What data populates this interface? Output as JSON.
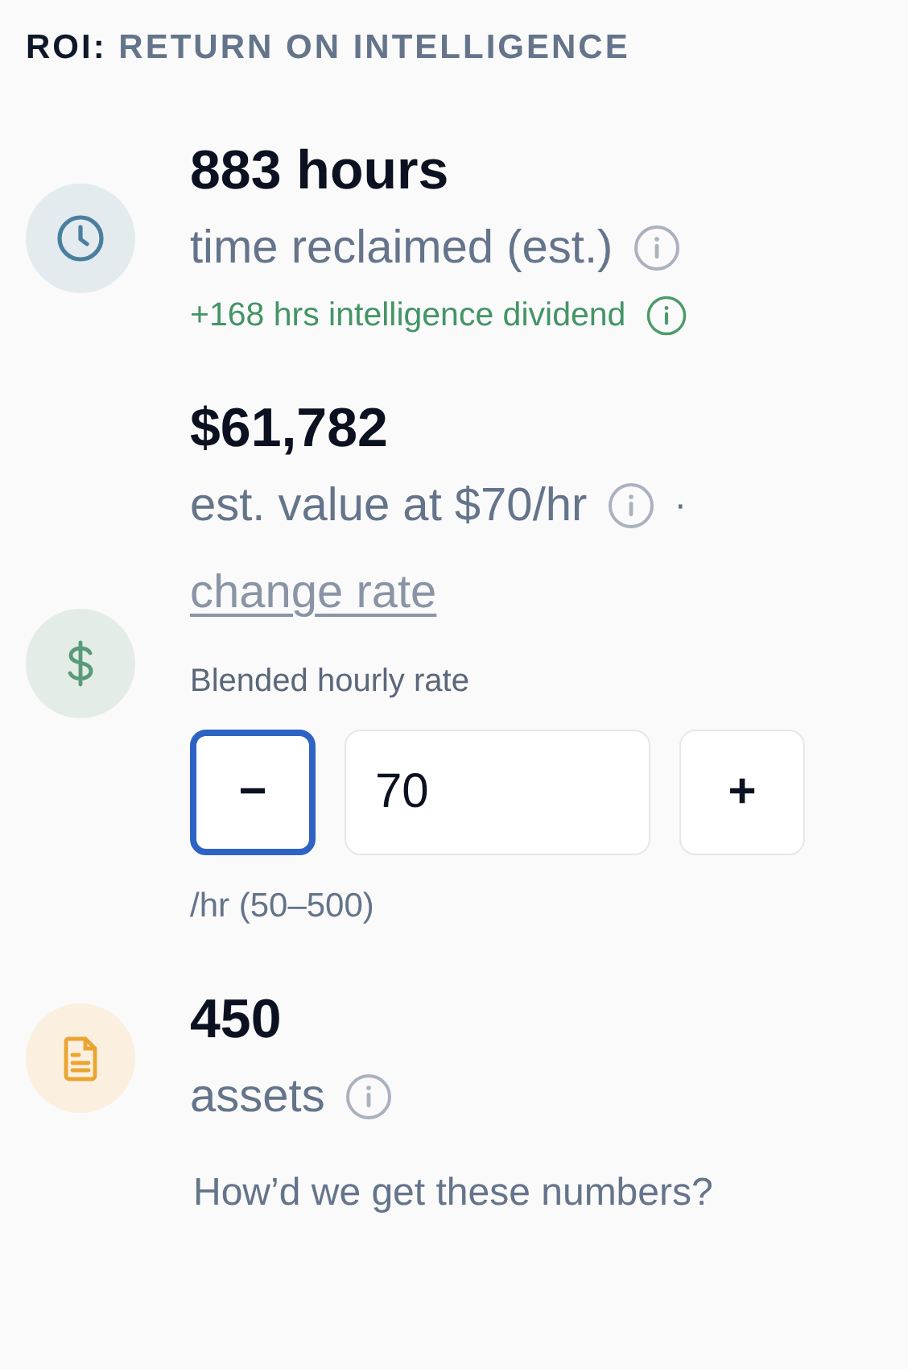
{
  "header": {
    "prefix": "ROI:",
    "title": "RETURN ON INTELLIGENCE"
  },
  "metrics": [
    {
      "kind": "clock",
      "value": "883 hours",
      "label": "time reclaimed (est.)",
      "info": true,
      "note": "+168 hrs intelligence dividend"
    },
    {
      "kind": "dollar",
      "value": "$61,782",
      "label": "est. value at $70/hr",
      "info": true,
      "separator": "·",
      "link": "change rate",
      "rate_editor": {
        "label": "Blended hourly rate",
        "decrement": {
          "label": "−",
          "focused": true
        },
        "value": "70",
        "increment": {
          "label": "+",
          "focused": false
        },
        "hint": "/hr (50–500)"
      }
    },
    {
      "kind": "document",
      "value": "450",
      "label": "assets",
      "info": true
    }
  ],
  "footer_link": "How’d we get these numbers?"
}
